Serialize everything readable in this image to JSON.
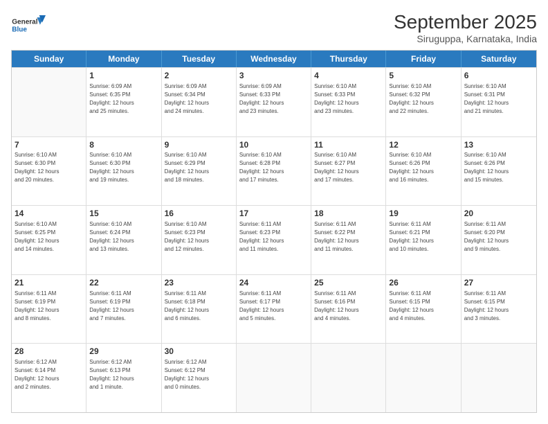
{
  "logo": {
    "line1": "General",
    "line2": "Blue"
  },
  "title": "September 2025",
  "subtitle": "Siruguppa, Karnataka, India",
  "weekdays": [
    "Sunday",
    "Monday",
    "Tuesday",
    "Wednesday",
    "Thursday",
    "Friday",
    "Saturday"
  ],
  "rows": [
    [
      {
        "day": "",
        "sunrise": "",
        "sunset": "",
        "daylight": ""
      },
      {
        "day": "1",
        "sunrise": "6:09 AM",
        "sunset": "6:35 PM",
        "daylight": "12 hours and 25 minutes."
      },
      {
        "day": "2",
        "sunrise": "6:09 AM",
        "sunset": "6:34 PM",
        "daylight": "12 hours and 24 minutes."
      },
      {
        "day": "3",
        "sunrise": "6:09 AM",
        "sunset": "6:33 PM",
        "daylight": "12 hours and 23 minutes."
      },
      {
        "day": "4",
        "sunrise": "6:10 AM",
        "sunset": "6:33 PM",
        "daylight": "12 hours and 23 minutes."
      },
      {
        "day": "5",
        "sunrise": "6:10 AM",
        "sunset": "6:32 PM",
        "daylight": "12 hours and 22 minutes."
      },
      {
        "day": "6",
        "sunrise": "6:10 AM",
        "sunset": "6:31 PM",
        "daylight": "12 hours and 21 minutes."
      }
    ],
    [
      {
        "day": "7",
        "sunrise": "6:10 AM",
        "sunset": "6:30 PM",
        "daylight": "12 hours and 20 minutes."
      },
      {
        "day": "8",
        "sunrise": "6:10 AM",
        "sunset": "6:30 PM",
        "daylight": "12 hours and 19 minutes."
      },
      {
        "day": "9",
        "sunrise": "6:10 AM",
        "sunset": "6:29 PM",
        "daylight": "12 hours and 18 minutes."
      },
      {
        "day": "10",
        "sunrise": "6:10 AM",
        "sunset": "6:28 PM",
        "daylight": "12 hours and 17 minutes."
      },
      {
        "day": "11",
        "sunrise": "6:10 AM",
        "sunset": "6:27 PM",
        "daylight": "12 hours and 17 minutes."
      },
      {
        "day": "12",
        "sunrise": "6:10 AM",
        "sunset": "6:26 PM",
        "daylight": "12 hours and 16 minutes."
      },
      {
        "day": "13",
        "sunrise": "6:10 AM",
        "sunset": "6:26 PM",
        "daylight": "12 hours and 15 minutes."
      }
    ],
    [
      {
        "day": "14",
        "sunrise": "6:10 AM",
        "sunset": "6:25 PM",
        "daylight": "12 hours and 14 minutes."
      },
      {
        "day": "15",
        "sunrise": "6:10 AM",
        "sunset": "6:24 PM",
        "daylight": "12 hours and 13 minutes."
      },
      {
        "day": "16",
        "sunrise": "6:10 AM",
        "sunset": "6:23 PM",
        "daylight": "12 hours and 12 minutes."
      },
      {
        "day": "17",
        "sunrise": "6:11 AM",
        "sunset": "6:23 PM",
        "daylight": "12 hours and 11 minutes."
      },
      {
        "day": "18",
        "sunrise": "6:11 AM",
        "sunset": "6:22 PM",
        "daylight": "12 hours and 11 minutes."
      },
      {
        "day": "19",
        "sunrise": "6:11 AM",
        "sunset": "6:21 PM",
        "daylight": "12 hours and 10 minutes."
      },
      {
        "day": "20",
        "sunrise": "6:11 AM",
        "sunset": "6:20 PM",
        "daylight": "12 hours and 9 minutes."
      }
    ],
    [
      {
        "day": "21",
        "sunrise": "6:11 AM",
        "sunset": "6:19 PM",
        "daylight": "12 hours and 8 minutes."
      },
      {
        "day": "22",
        "sunrise": "6:11 AM",
        "sunset": "6:19 PM",
        "daylight": "12 hours and 7 minutes."
      },
      {
        "day": "23",
        "sunrise": "6:11 AM",
        "sunset": "6:18 PM",
        "daylight": "12 hours and 6 minutes."
      },
      {
        "day": "24",
        "sunrise": "6:11 AM",
        "sunset": "6:17 PM",
        "daylight": "12 hours and 5 minutes."
      },
      {
        "day": "25",
        "sunrise": "6:11 AM",
        "sunset": "6:16 PM",
        "daylight": "12 hours and 4 minutes."
      },
      {
        "day": "26",
        "sunrise": "6:11 AM",
        "sunset": "6:15 PM",
        "daylight": "12 hours and 4 minutes."
      },
      {
        "day": "27",
        "sunrise": "6:11 AM",
        "sunset": "6:15 PM",
        "daylight": "12 hours and 3 minutes."
      }
    ],
    [
      {
        "day": "28",
        "sunrise": "6:12 AM",
        "sunset": "6:14 PM",
        "daylight": "12 hours and 2 minutes."
      },
      {
        "day": "29",
        "sunrise": "6:12 AM",
        "sunset": "6:13 PM",
        "daylight": "12 hours and 1 minute."
      },
      {
        "day": "30",
        "sunrise": "6:12 AM",
        "sunset": "6:12 PM",
        "daylight": "12 hours and 0 minutes."
      },
      {
        "day": "",
        "sunrise": "",
        "sunset": "",
        "daylight": ""
      },
      {
        "day": "",
        "sunrise": "",
        "sunset": "",
        "daylight": ""
      },
      {
        "day": "",
        "sunrise": "",
        "sunset": "",
        "daylight": ""
      },
      {
        "day": "",
        "sunrise": "",
        "sunset": "",
        "daylight": ""
      }
    ]
  ]
}
